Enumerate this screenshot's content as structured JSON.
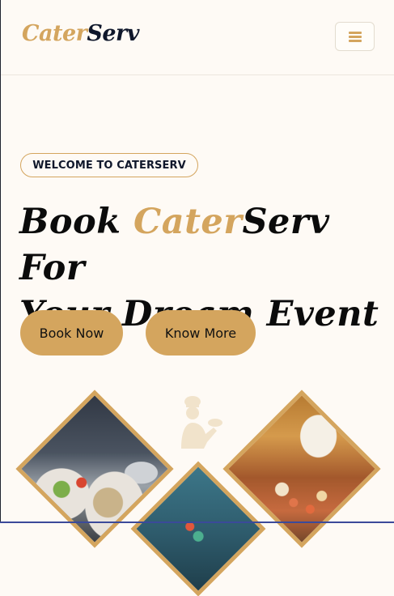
{
  "header": {
    "logo_accent": "Cater",
    "logo_dark": "Serv"
  },
  "hero": {
    "badge": "WELCOME TO CATERSERV",
    "title_part1": "Book ",
    "title_accent": "Cater",
    "title_part2": "Serv For",
    "title_line2": "Your Dream Event"
  },
  "buttons": {
    "book_now": "Book Now",
    "know_more": "Know More"
  },
  "icons": {
    "menu": "hamburger-menu-icon",
    "chef": "chef-icon"
  },
  "colors": {
    "accent": "#d4a55e",
    "background": "#fefaf5",
    "text_dark": "#0f172b"
  }
}
